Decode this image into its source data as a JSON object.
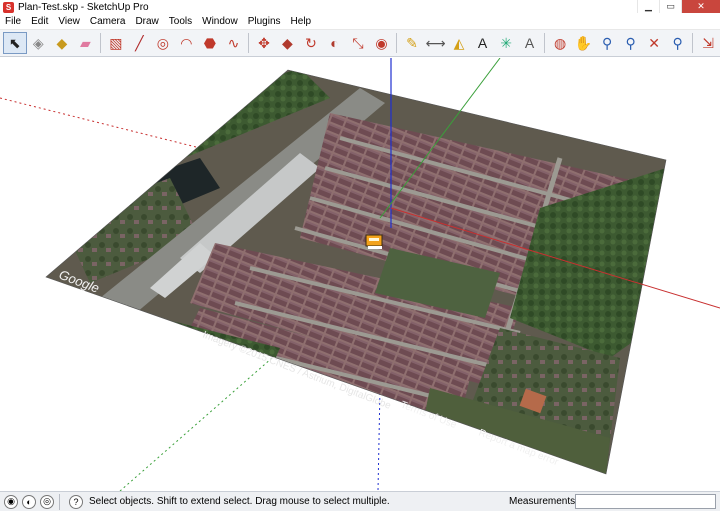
{
  "window": {
    "title": "Plan-Test.skp - SketchUp Pro",
    "app_icon_glyph": "S"
  },
  "menu": [
    "File",
    "Edit",
    "View",
    "Camera",
    "Draw",
    "Tools",
    "Window",
    "Plugins",
    "Help"
  ],
  "toolbar": {
    "tools": [
      {
        "name": "select-tool",
        "glyph": "⬉",
        "color": "#222"
      },
      {
        "name": "make-component-tool",
        "glyph": "◈",
        "color": "#888"
      },
      {
        "name": "paint-bucket-tool",
        "glyph": "◆",
        "color": "#c89a1e"
      },
      {
        "name": "eraser-tool",
        "glyph": "▰",
        "color": "#e07aa0"
      },
      {
        "sep": true
      },
      {
        "name": "rectangle-tool",
        "glyph": "▧",
        "color": "#c0392b"
      },
      {
        "name": "line-tool",
        "glyph": "╱",
        "color": "#b02a2a"
      },
      {
        "name": "circle-tool",
        "glyph": "◎",
        "color": "#c0392b"
      },
      {
        "name": "arc-tool",
        "glyph": "◠",
        "color": "#c0392b"
      },
      {
        "name": "polygon-tool",
        "glyph": "⬣",
        "color": "#c0392b"
      },
      {
        "name": "freehand-tool",
        "glyph": "∿",
        "color": "#c0392b"
      },
      {
        "sep": true
      },
      {
        "name": "move-tool",
        "glyph": "✥",
        "color": "#c0392b"
      },
      {
        "name": "push-pull-tool",
        "glyph": "◆",
        "color": "#b03a2e"
      },
      {
        "name": "rotate-tool",
        "glyph": "↻",
        "color": "#c0392b"
      },
      {
        "name": "follow-me-tool",
        "glyph": "◐",
        "color": "#b03a2e"
      },
      {
        "name": "scale-tool",
        "glyph": "⤡",
        "color": "#c0392b"
      },
      {
        "name": "offset-tool",
        "glyph": "◉",
        "color": "#c0392b"
      },
      {
        "sep": true
      },
      {
        "name": "tape-measure-tool",
        "glyph": "✎",
        "color": "#d4a017"
      },
      {
        "name": "dimension-tool",
        "glyph": "⟷",
        "color": "#555"
      },
      {
        "name": "protractor-tool",
        "glyph": "◭",
        "color": "#d4a017"
      },
      {
        "name": "text-tool",
        "glyph": "A",
        "color": "#222"
      },
      {
        "name": "axes-tool",
        "glyph": "✳",
        "color": "#2a7"
      },
      {
        "name": "3d-text-tool",
        "glyph": "A",
        "color": "#555"
      },
      {
        "sep": true
      },
      {
        "name": "orbit-tool",
        "glyph": "◍",
        "color": "#c0392b"
      },
      {
        "name": "pan-tool",
        "glyph": "✋",
        "color": "#666"
      },
      {
        "name": "zoom-tool",
        "glyph": "⚲",
        "color": "#2a5db0"
      },
      {
        "name": "zoom-window-tool",
        "glyph": "⚲",
        "color": "#2a5db0"
      },
      {
        "name": "zoom-extents-tool",
        "glyph": "✕",
        "color": "#c0392b"
      },
      {
        "name": "previous-view-tool",
        "glyph": "⚲",
        "color": "#2a5db0"
      },
      {
        "sep": true
      },
      {
        "name": "next-tool",
        "glyph": "⇲",
        "color": "#c0392b"
      }
    ]
  },
  "viewport": {
    "watermark_google": "Google",
    "imagery_credit": "Imagery ©2015 CNES / Astrium, DigitalGlobe",
    "terms_link": "Terms of Use",
    "report_link": "Report a map error",
    "colors": {
      "red_axis": "#c83030",
      "green_axis": "#3aa03a",
      "blue_axis": "#2030d0"
    }
  },
  "status": {
    "icons": [
      "geo-location-icon",
      "credits-icon",
      "user-icon",
      "help-icon"
    ],
    "icon_glyphs": [
      "◉",
      "◐",
      "◎",
      "?"
    ],
    "message": "Select objects. Shift to extend select. Drag mouse to select multiple.",
    "measurements_label": "Measurements",
    "measurements_value": ""
  }
}
